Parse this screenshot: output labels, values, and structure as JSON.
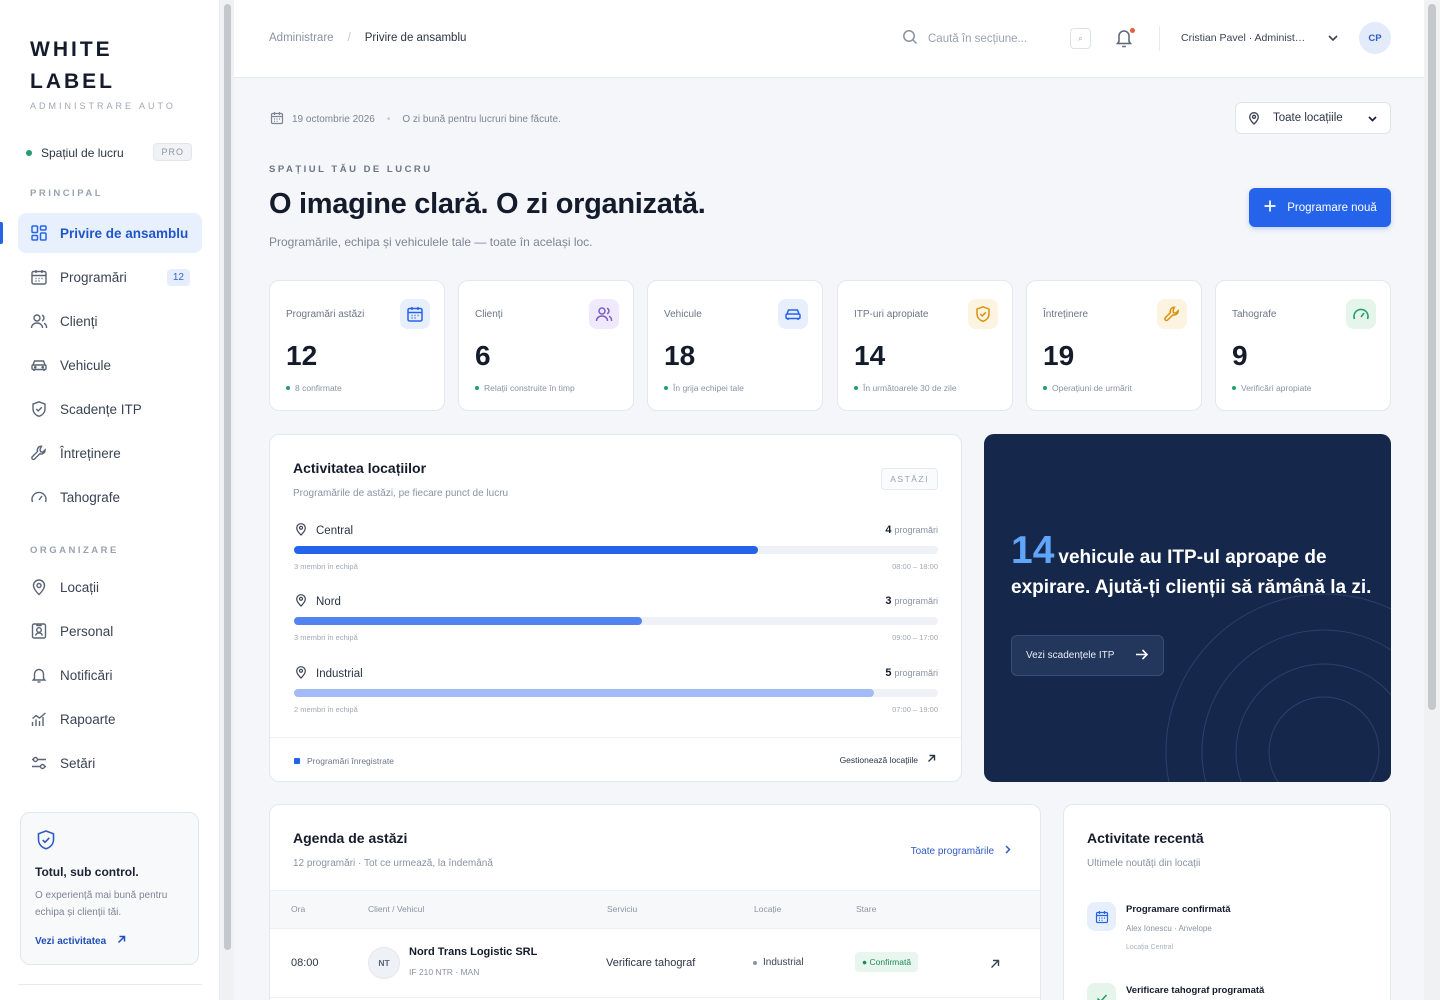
{
  "sidebar": {
    "logo_line1": "WHITE",
    "logo_line2": "LABEL",
    "logo_sub": "ADMINISTRARE AUTO",
    "workspace": "Spațiul de lucru",
    "workspace_badge": "PRO",
    "section_main": "PRINCIPAL",
    "section_org": "ORGANIZARE",
    "items": [
      {
        "label": "Privire de ansamblu",
        "icon": "grid-icon",
        "active": true
      },
      {
        "label": "Programări",
        "icon": "calendar-icon",
        "count": "12"
      },
      {
        "label": "Clienți",
        "icon": "users-icon"
      },
      {
        "label": "Vehicule",
        "icon": "car-icon"
      },
      {
        "label": "Scadențe ITP",
        "icon": "shield-icon"
      },
      {
        "label": "Întreținere",
        "icon": "wrench-icon"
      },
      {
        "label": "Tahografe",
        "icon": "gauge-icon"
      }
    ],
    "org_items": [
      {
        "label": "Locații",
        "icon": "map-pin-icon"
      },
      {
        "label": "Personal",
        "icon": "id-badge-icon"
      },
      {
        "label": "Notificări",
        "icon": "bell-icon"
      },
      {
        "label": "Rapoarte",
        "icon": "chart-icon"
      },
      {
        "label": "Setări",
        "icon": "sliders-icon"
      }
    ],
    "promo": {
      "title": "Totul, sub control.",
      "text": "O experiență mai bună pentru echipa și clienții tăi.",
      "link": "Vezi activitatea"
    }
  },
  "topbar": {
    "breadcrumb_root": "Administrare",
    "breadcrumb_sep": "/",
    "breadcrumb_current": "Privire de ansamblu",
    "search_placeholder": "Caută în secțiune...",
    "kbd": "⌕",
    "user": "Cristian Pavel · Administrator",
    "avatar": "CP"
  },
  "main": {
    "date": "19 octombrie 2026",
    "greeting": "O zi bună pentru lucruri bine făcute.",
    "location_select": "Toate locațiile",
    "eyebrow": "SPAȚIUL TĂU DE LUCRU",
    "headline": "O imagine clară. O zi organizată.",
    "subline": "Programările, echipa și vehiculele tale — toate în același loc.",
    "new_button": "Programare nouă"
  },
  "stats": [
    {
      "label": "Programări astăzi",
      "value": "12",
      "note": "8 confirmate",
      "icon": "calendar-icon",
      "color": "#2563eb",
      "bg": "#e8effc"
    },
    {
      "label": "Clienți",
      "value": "6",
      "note": "Relații construite în timp",
      "icon": "users-icon",
      "color": "#7c5cc4",
      "bg": "#efeafb"
    },
    {
      "label": "Vehicule",
      "value": "18",
      "note": "În grija echipei tale",
      "icon": "car-icon",
      "color": "#2563eb",
      "bg": "#e8effc"
    },
    {
      "label": "ITP-uri apropiate",
      "value": "14",
      "note": "În următoarele 30 de zile",
      "icon": "shield-icon",
      "color": "#d9920f",
      "bg": "#fdf3e1"
    },
    {
      "label": "Întreținere",
      "value": "19",
      "note": "Operațiuni de urmărit",
      "icon": "wrench-icon",
      "color": "#d9920f",
      "bg": "#fdf3e1"
    },
    {
      "label": "Tahografe",
      "value": "9",
      "note": "Verificări apropiate",
      "icon": "gauge-icon",
      "color": "#22a06b",
      "bg": "#e5f5ec"
    }
  ],
  "activity": {
    "title": "Activitatea locațiilor",
    "subtitle": "Programările de astăzi, pe fiecare punct de lucru",
    "tag": "ASTĂZI",
    "unit": "programări",
    "locations": [
      {
        "name": "Central",
        "count": "4",
        "progress": 0.72,
        "color": "#2563eb",
        "team": "3 membri în echipă",
        "hours": "08:00 – 18:00"
      },
      {
        "name": "Nord",
        "count": "3",
        "progress": 0.54,
        "color": "#5283ee",
        "team": "3 membri în echipă",
        "hours": "09:00 – 17:00"
      },
      {
        "name": "Industrial",
        "count": "5",
        "progress": 0.9,
        "color": "#a3bbf5",
        "team": "2 membri în echipă",
        "hours": "07:00 – 19:00"
      }
    ],
    "legend": "Programări înregistrate",
    "manage_link": "Gestionează locațiile"
  },
  "itp": {
    "number": "14",
    "text": "vehicule au ITP-ul aproape de expirare. Ajută-ți clienții să rămână la zi.",
    "button": "Vezi scadențele ITP"
  },
  "agenda": {
    "title": "Agenda de astăzi",
    "subtitle": "12 programări · Tot ce urmează, la îndemână",
    "link": "Toate programările",
    "columns": [
      "Ora",
      "Client / Vehicul",
      "Serviciu",
      "Locație",
      "Stare"
    ],
    "rows": [
      {
        "time": "08:00",
        "initials": "NT",
        "client": "Nord Trans Logistic SRL",
        "vehicle": "IF 210 NTR · MAN",
        "service": "Verificare tahograf",
        "location": "Industrial",
        "status": "Confirmată"
      }
    ]
  },
  "recent": {
    "title": "Activitate recentă",
    "subtitle": "Ultimele noutăți din locații",
    "items": [
      {
        "title": "Programare confirmată",
        "meta": "Alex Ionescu · Anvelope",
        "loc": "Locația Central",
        "icon": "calendar-icon"
      },
      {
        "title": "Verificare tahograf programată",
        "meta": "",
        "loc": "",
        "icon": "check-icon"
      }
    ]
  }
}
